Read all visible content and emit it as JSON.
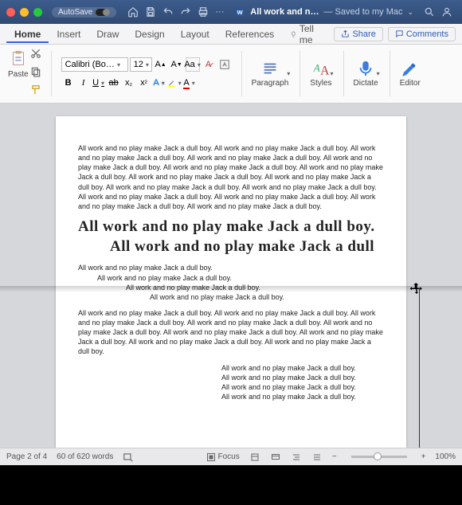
{
  "titlebar": {
    "autosave": "AutoSave",
    "doc_name": "All work and n…",
    "saved_status": "— Saved to my Mac"
  },
  "tabs": {
    "home": "Home",
    "insert": "Insert",
    "draw": "Draw",
    "design": "Design",
    "layout": "Layout",
    "references": "References",
    "tellme": "Tell me",
    "share": "Share",
    "comments": "Comments"
  },
  "ribbon": {
    "paste": "Paste",
    "font_name": "Calibri (Bo…",
    "font_size": "12",
    "paragraph": "Paragraph",
    "styles": "Styles",
    "dictate": "Dictate",
    "editor": "Editor"
  },
  "doc": {
    "p1": "All work and no play make Jack a dull boy. All work and no play make Jack a dull boy. All work and no play make Jack a dull boy. All work and no play make Jack a dull boy. All work and no play make Jack a dull boy. All work and no play make Jack a dull boy. All work and no play make Jack a dull boy. All work and no play make Jack a dull boy. All work and no play make Jack a dull boy. All work and no play make Jack a dull boy. All work and no play make Jack a dull boy. All work and no play make Jack a dull boy. All work and no play make Jack a dull boy. All work and no play make Jack a dull boy. All work and no play make Jack a dull boy.",
    "hw1": "All work and no play make Jack a dull boy.",
    "hw2": "All work and no play make Jack a dull",
    "s1": "All work and no play make Jack a dull boy.",
    "s2": "All work and no play make Jack a dull boy.",
    "s3": "All work and no play make Jack a dull boy.",
    "s4": "All work and no play make Jack a dull boy.",
    "p2": "All work and no play make Jack a dull boy. All work and no play make Jack a dull boy. All work and no play make Jack a dull boy. All work and no play make Jack a dull boy. All work and no play make Jack a dull boy. All work and no play make Jack a dull boy. All work and no play make Jack a dull boy. All work and no play make Jack a dull boy. All work and no play make Jack a dull boy.",
    "r1": "All work and no play make Jack a dull boy.",
    "r2": "All work and no play make Jack a dull boy.",
    "r3": "All work and no play make Jack a dull boy.",
    "r4": "All work and no play make Jack a dull boy."
  },
  "status": {
    "page": "Page 2 of 4",
    "words": "60 of 620 words",
    "focus": "Focus",
    "zoom": "100%",
    "minus": "−",
    "plus": "+"
  }
}
